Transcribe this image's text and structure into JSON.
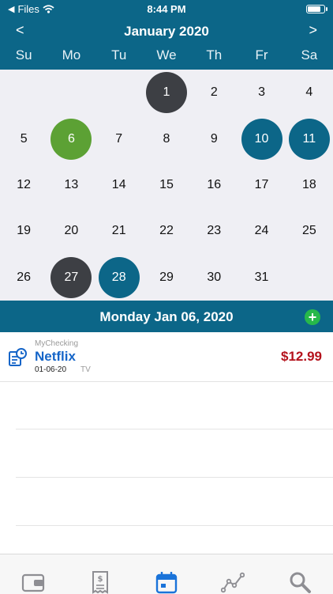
{
  "status": {
    "carrier": "Files",
    "time": "8:44 PM",
    "battery_level": 0.85
  },
  "calendar": {
    "month_label": "January 2020",
    "prev_label": "<",
    "next_label": ">",
    "weekdays": [
      "Su",
      "Mo",
      "Tu",
      "We",
      "Th",
      "Fr",
      "Sa"
    ],
    "days": [
      "",
      "",
      "",
      "1",
      "2",
      "3",
      "4",
      "5",
      "6",
      "7",
      "8",
      "9",
      "10",
      "11",
      "12",
      "13",
      "14",
      "15",
      "16",
      "17",
      "18",
      "19",
      "20",
      "21",
      "22",
      "23",
      "24",
      "25",
      "26",
      "27",
      "28",
      "29",
      "30",
      "31",
      ""
    ],
    "today_days": [
      "1",
      "27"
    ],
    "selected_day": "6",
    "highlight_days": [
      "10",
      "11",
      "28"
    ]
  },
  "selection": {
    "date_label": "Monday Jan 06, 2020",
    "add_label": "+"
  },
  "transactions": [
    {
      "account": "MyChecking",
      "payee": "Netflix",
      "date": "01-06-20",
      "category": "TV",
      "amount": "$12.99"
    }
  ],
  "colors": {
    "header": "#0c6688",
    "today": "#3d3f44",
    "selected": "#5ca134",
    "highlight": "#0c6688",
    "amount": "#b4121c",
    "payee": "#1565c8",
    "add": "#27b84a"
  },
  "tabs": [
    {
      "icon": "wallet-icon",
      "active": false
    },
    {
      "icon": "receipt-icon",
      "active": false
    },
    {
      "icon": "calendar-icon",
      "active": true
    },
    {
      "icon": "chart-icon",
      "active": false
    },
    {
      "icon": "search-icon",
      "active": false
    }
  ]
}
